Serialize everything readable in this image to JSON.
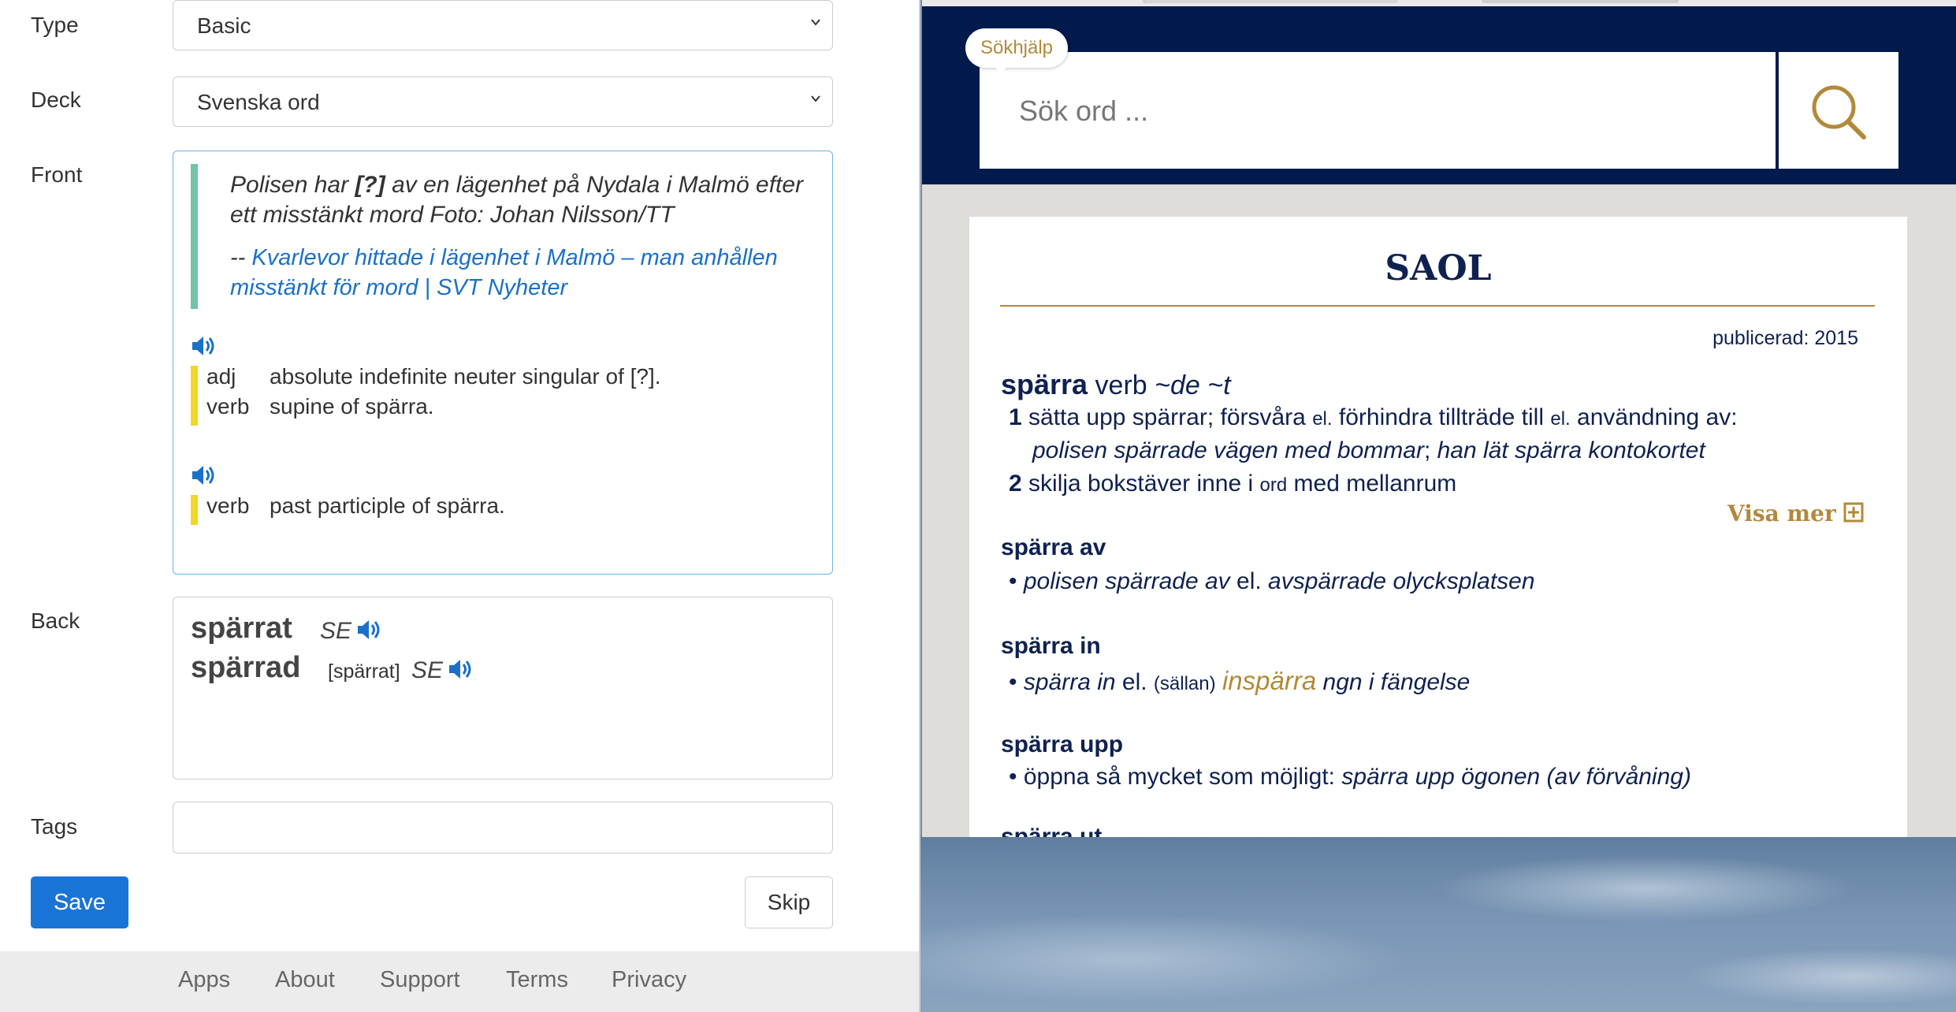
{
  "form": {
    "type_label": "Type",
    "type_value": "Basic",
    "deck_label": "Deck",
    "deck_value": "Svenska ord",
    "front_label": "Front",
    "back_label": "Back",
    "tags_label": "Tags",
    "tags_value": "",
    "save_label": "Save",
    "skip_label": "Skip"
  },
  "front": {
    "quote_pre": "Polisen har ",
    "quote_bold": "[?]",
    "quote_post": " av en lägenhet på Nydala i Malmö efter ett misstänkt mord Foto: Johan Nilsson/TT",
    "source_prefix": "-- ",
    "source_link": "Kvarlevor hittade i lägenhet i Malmö – man anhållen misstänkt för mord | SVT Nyheter",
    "defs1": [
      {
        "pos": "adj",
        "gloss": "absolute indefinite neuter singular of [?]."
      },
      {
        "pos": "verb",
        "gloss": "supine of spärra."
      }
    ],
    "defs2": [
      {
        "pos": "verb",
        "gloss": "past participle of spärra."
      }
    ]
  },
  "back": {
    "word1": "spärrat",
    "word1_lang": "SE",
    "word2": "spärrad",
    "word2_note": "[spärrat]",
    "word2_lang": "SE"
  },
  "footer": [
    "Apps",
    "About",
    "Support",
    "Terms",
    "Privacy"
  ],
  "saol": {
    "help_bubble": "Sökhjälp",
    "search_placeholder": "Sök ord ...",
    "title": "SAOL",
    "published": "publicerad: 2015",
    "headword": "spärra",
    "headword_class": "verb",
    "headword_forms": "~de ~t",
    "sense1_num": "1",
    "sense1_a": "sätta upp spärrar; försvåra ",
    "sense1_el1": "el.",
    "sense1_b": " förhindra tillträde till ",
    "sense1_el2": "el.",
    "sense1_c": " användning av:",
    "sense1_example": "polisen spärrade vägen med bommar",
    "sense1_sep": "; ",
    "sense1_example2": "han lät spärra kontokortet",
    "sense2_num": "2",
    "sense2_a": "skilja bokstäver inne i ",
    "sense2_ord": "ord",
    "sense2_b": " med mellanrum",
    "visa_mer": "Visa mer",
    "phrases": [
      {
        "head": "spärra av"
      },
      {
        "head": "spärra in"
      },
      {
        "head": "spärra upp"
      },
      {
        "head": "spärra ut"
      }
    ],
    "p1_ex1": "polisen spärrade av",
    "p1_el": " el. ",
    "p1_ex2": "avspärrade olycksplatsen",
    "p2_ex1": "spärra in",
    "p2_el": " el. ",
    "p2_note": "(sällan)",
    "p2_gold": "inspärra",
    "p2_ex2": "ngn i fängelse",
    "p3_a": "öppna så mycket som möjligt: ",
    "p3_ex": "spärra upp ögonen (av förvåning)"
  }
}
